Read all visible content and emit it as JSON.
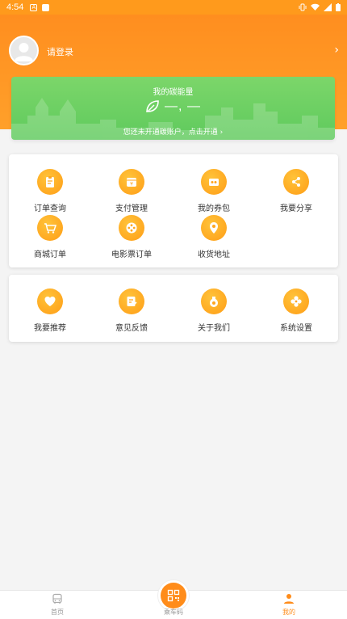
{
  "status_bar": {
    "time": "4:54"
  },
  "header": {
    "login_text": "请登录"
  },
  "carbon": {
    "title": "我的碳能量",
    "value": "—, —",
    "hint": "您还未开通碳账户，点击开通 ›"
  },
  "menu1": [
    {
      "label": "订单查询",
      "icon": "clipboard-icon"
    },
    {
      "label": "支付管理",
      "icon": "wallet-icon"
    },
    {
      "label": "我的券包",
      "icon": "coupon-icon"
    },
    {
      "label": "我要分享",
      "icon": "share-icon"
    },
    {
      "label": "商城订单",
      "icon": "cart-icon"
    },
    {
      "label": "电影票订单",
      "icon": "film-reel-icon"
    },
    {
      "label": "收货地址",
      "icon": "location-pin-icon"
    }
  ],
  "menu2": [
    {
      "label": "我要推荐",
      "icon": "heart-icon"
    },
    {
      "label": "意见反馈",
      "icon": "feedback-icon"
    },
    {
      "label": "关于我们",
      "icon": "info-icon"
    },
    {
      "label": "系统设置",
      "icon": "gear-icon"
    }
  ],
  "bottom_nav": {
    "home": "首页",
    "qr": "乘车码",
    "mine": "我的"
  },
  "colors": {
    "accent": "#ff8c1a",
    "carbon_green": "#5fca5d"
  }
}
